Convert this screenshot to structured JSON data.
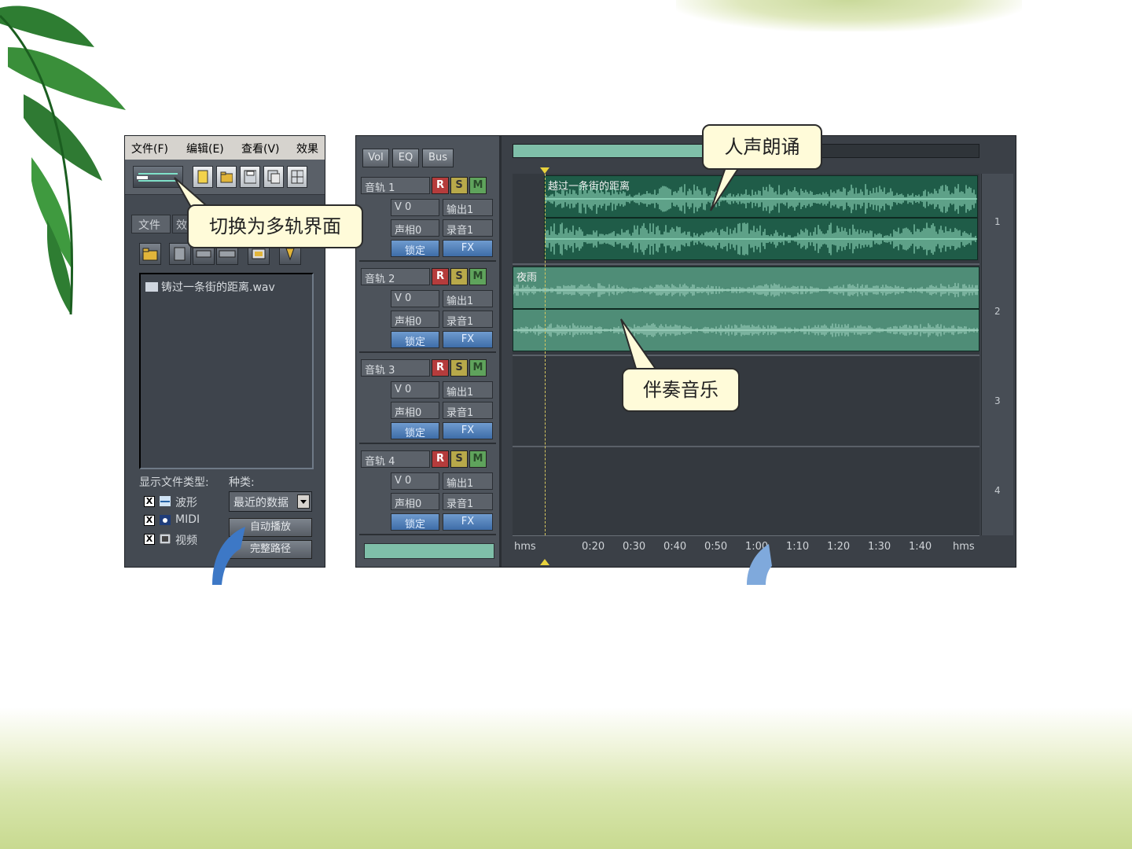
{
  "left_panel": {
    "menu": [
      "文件(F)",
      "编辑(E)",
      "查看(V)",
      "效果"
    ],
    "file_tabs": [
      "文件",
      "效"
    ],
    "file_list": [
      "铸过一条街的距离.wav"
    ],
    "show_types_label": "显示文件类型:",
    "kind_label": "种类:",
    "types": [
      {
        "checked": "X",
        "label": "波形",
        "icon": "waveform-icon"
      },
      {
        "checked": "X",
        "label": "MIDI",
        "icon": "midi-icon"
      },
      {
        "checked": "X",
        "label": "视频",
        "icon": "video-icon"
      }
    ],
    "kind_selected": "最近的数据",
    "buttons": [
      "自动播放",
      "完整路径"
    ]
  },
  "multitrack": {
    "mode_tabs": [
      "Vol",
      "EQ",
      "Bus"
    ],
    "tracks": [
      {
        "name": "音轨 1",
        "r": "R",
        "s": "S",
        "m": "M",
        "vol": "V 0",
        "out": "输出1",
        "pan": "声相0",
        "rec": "录音1",
        "lock": "锁定",
        "fx": "FX",
        "lane_num": "1"
      },
      {
        "name": "音轨 2",
        "r": "R",
        "s": "S",
        "m": "M",
        "vol": "V 0",
        "out": "输出1",
        "pan": "声相0",
        "rec": "录音1",
        "lock": "锁定",
        "fx": "FX",
        "lane_num": "2"
      },
      {
        "name": "音轨 3",
        "r": "R",
        "s": "S",
        "m": "M",
        "vol": "V 0",
        "out": "输出1",
        "pan": "声相0",
        "rec": "录音1",
        "lock": "锁定",
        "fx": "FX",
        "lane_num": "3"
      },
      {
        "name": "音轨 4",
        "r": "R",
        "s": "S",
        "m": "M",
        "vol": "V 0",
        "out": "输出1",
        "pan": "声相0",
        "rec": "录音1",
        "lock": "锁定",
        "fx": "FX",
        "lane_num": "4"
      }
    ],
    "clips": {
      "track1": "越过一条街的距离",
      "track2": "夜雨"
    },
    "ruler": [
      "hms",
      "0:20",
      "0:30",
      "0:40",
      "0:50",
      "1:00",
      "1:10",
      "1:20",
      "1:30",
      "1:40",
      "hms"
    ]
  },
  "callouts": {
    "switch": "切换为多轨界面",
    "vocal": "人声朗诵",
    "music": "伴奏音乐"
  },
  "colors": {
    "clip_vocal": "#1f5c48",
    "clip_music": "#4f8d77",
    "callout_bg": "#fffbd9"
  }
}
